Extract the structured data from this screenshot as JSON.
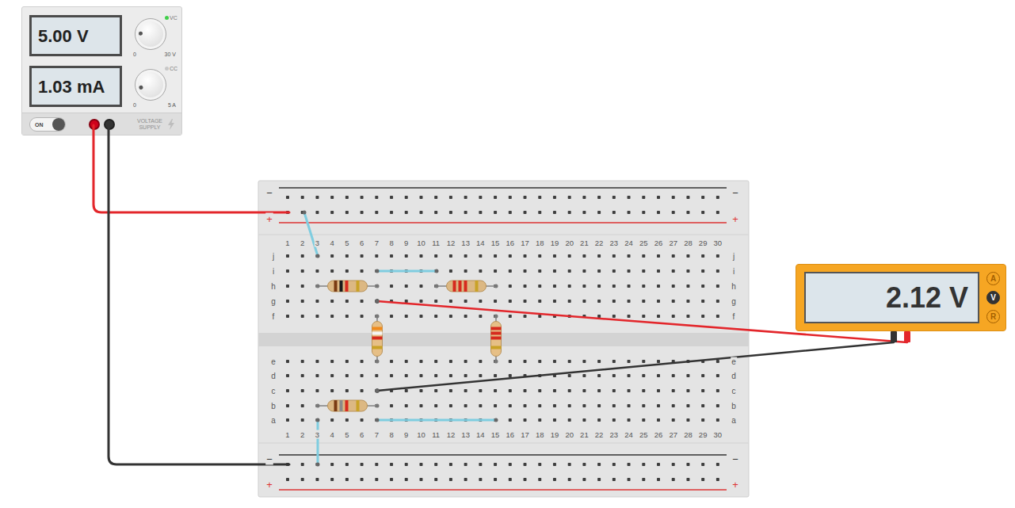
{
  "power_supply": {
    "voltage": "5.00 V",
    "current": "1.03 mA",
    "knobs": [
      {
        "min": "0",
        "max": "30 V",
        "level": 0.17
      },
      {
        "min": "0",
        "max": "5 A",
        "level": 0.1
      }
    ],
    "indicators": [
      {
        "label": "VC",
        "on": true
      },
      {
        "label": "CC",
        "on": false
      }
    ],
    "switch": {
      "label": "ON",
      "on": true
    },
    "terminals": [
      {
        "color": "#d0021b"
      },
      {
        "color": "#333333"
      }
    ],
    "caption": "VOLTAGE SUPPLY"
  },
  "breadboard": {
    "rails": {
      "top": [
        "−",
        "+"
      ],
      "bottom": [
        "−",
        "+"
      ]
    },
    "columns": [
      "1",
      "2",
      "3",
      "4",
      "5",
      "6",
      "7",
      "8",
      "9",
      "10",
      "11",
      "12",
      "13",
      "14",
      "15",
      "16",
      "17",
      "18",
      "19",
      "20",
      "21",
      "22",
      "23",
      "24",
      "25",
      "26",
      "27",
      "28",
      "29",
      "30"
    ],
    "rows_top": [
      "j",
      "i",
      "h",
      "g",
      "f"
    ],
    "rows_bottom": [
      "e",
      "d",
      "c",
      "b",
      "a"
    ]
  },
  "resistors": [
    {
      "bands": [
        "#7a3b12",
        "#1a1a1a",
        "#d62a1e",
        "#c9a227"
      ]
    },
    {
      "bands": [
        "#d62a1e",
        "#d62a1e",
        "#d62a1e",
        "#c9a227"
      ]
    },
    {
      "bands": [
        "#f08a1c",
        "#f5f5f5",
        "#d62a1e",
        "#c9a227"
      ]
    },
    {
      "bands": [
        "#d62a1e",
        "#d62a1e",
        "#d62a1e",
        "#c9a227"
      ]
    },
    {
      "bands": [
        "#7a3b12",
        "#8a8a8a",
        "#d62a1e",
        "#c9a227"
      ]
    }
  ],
  "wires": [
    {
      "color": "#e3262b"
    },
    {
      "color": "#333333"
    },
    {
      "color": "#7fcde0"
    },
    {
      "color": "#7fcde0"
    },
    {
      "color": "#7fcde0"
    },
    {
      "color": "#7fcde0"
    },
    {
      "color": "#e3262b"
    },
    {
      "color": "#333333"
    }
  ],
  "multimeter": {
    "reading": "2.12 V",
    "modes": [
      {
        "label": "A",
        "selected": false
      },
      {
        "label": "V",
        "selected": true
      },
      {
        "label": "R",
        "selected": false
      }
    ]
  }
}
